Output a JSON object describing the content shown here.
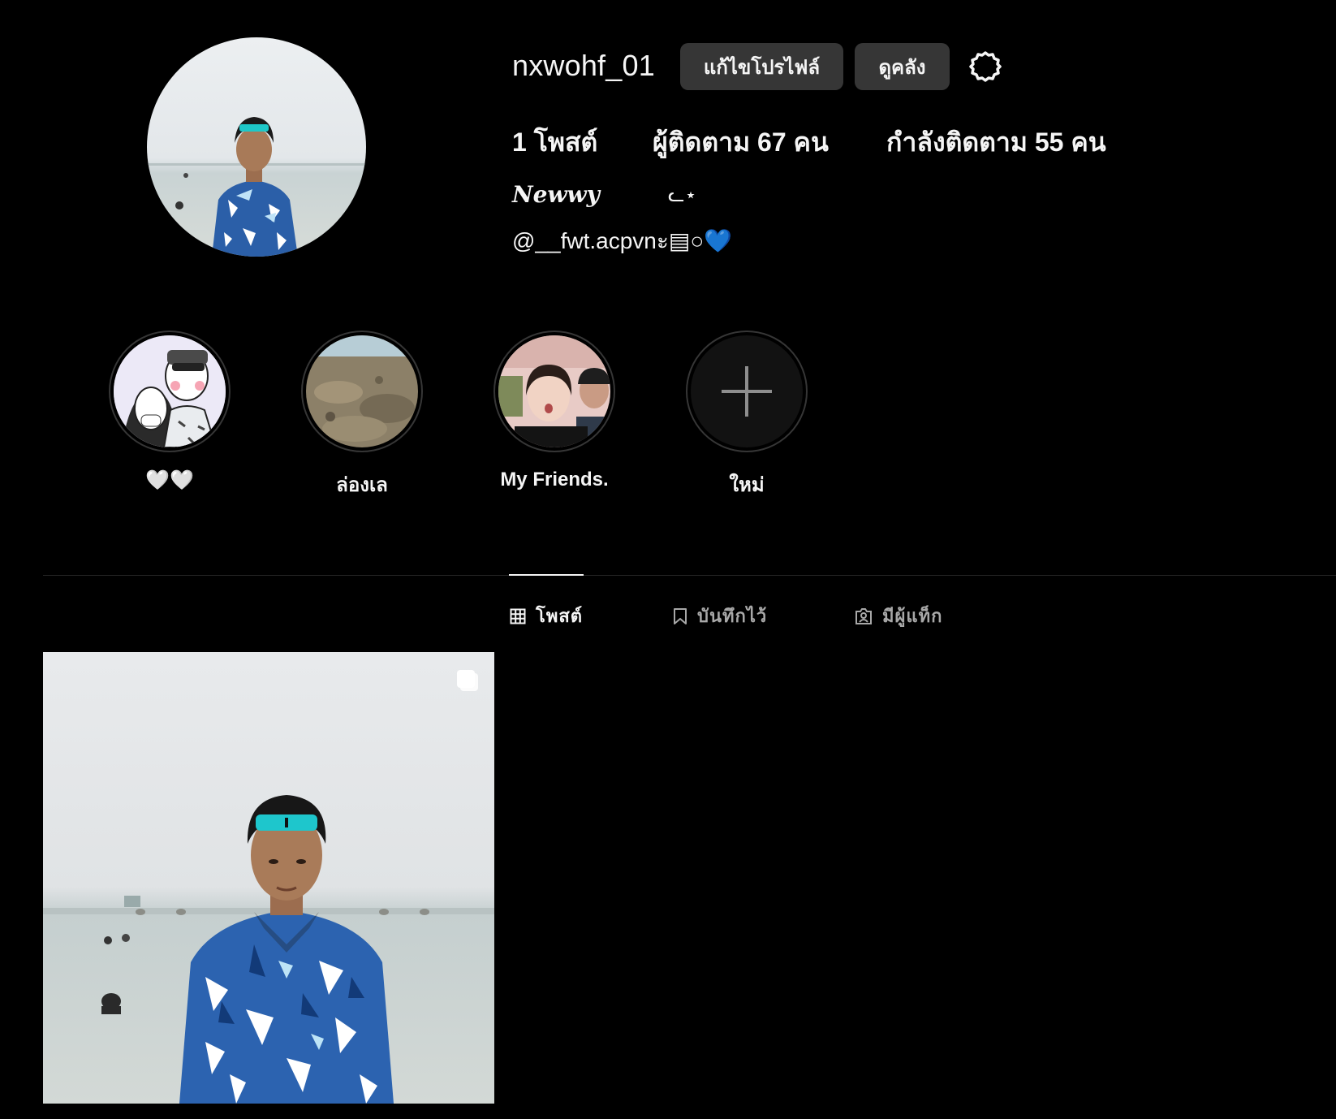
{
  "profile": {
    "username": "nxwohf_01",
    "edit_profile_label": "แก้ไขโปรไฟล์",
    "view_archive_label": "ดูคลัง",
    "settings_icon": "gear-icon"
  },
  "stats": {
    "posts": "1 โพสต์",
    "followers": "ผู้ติดตาม 67 คน",
    "following": "กำลังติดตาม 55 คน"
  },
  "bio": {
    "name": "Newwy",
    "symbol": "ᓚ⋆",
    "line": "@__fwt.acpvnะ▤○💙"
  },
  "highlights": [
    {
      "label": "🤍🤍"
    },
    {
      "label": "ล่องเล"
    },
    {
      "label": "My Friends."
    },
    {
      "label": "ใหม่"
    }
  ],
  "tabs": {
    "posts": "โพสต์",
    "saved": "บันทึกไว้",
    "tagged": "มีผู้แท็ก"
  },
  "colors": {
    "background": "#000000",
    "button": "#363636",
    "muted_text": "#a8a8a8"
  }
}
